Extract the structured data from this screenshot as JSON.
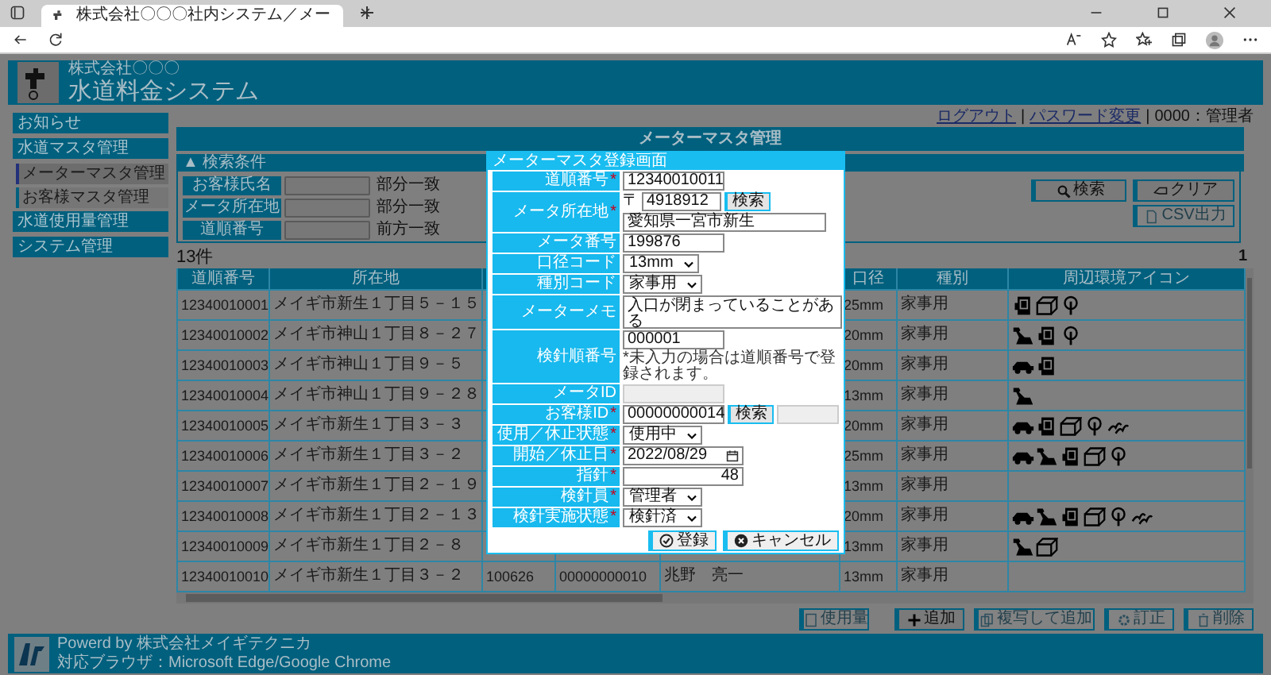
{
  "browser": {
    "tab_title": "株式会社〇〇〇社内システム／メー"
  },
  "header": {
    "company": "株式会社〇〇〇",
    "system": "水道料金システム"
  },
  "user_bar": {
    "logout": "ログアウト",
    "separator": "|",
    "password": "パスワード変更",
    "user": "0000：管理者"
  },
  "sidebar": {
    "items": [
      {
        "label": "お知らせ"
      },
      {
        "label": "水道マスタ管理",
        "children": [
          {
            "label": "メーターマスタ管理",
            "selected": true
          },
          {
            "label": "お客様マスタ管理",
            "selected": false
          }
        ]
      },
      {
        "label": "水道使用量管理"
      },
      {
        "label": "システム管理"
      }
    ]
  },
  "page_title": "メーターマスタ管理",
  "search": {
    "toggle": "▲",
    "title": "検索条件",
    "fields": [
      {
        "label": "お客様氏名",
        "match": "部分一致"
      },
      {
        "label": "メータ所在地",
        "match": "部分一致"
      },
      {
        "label": "道順番号",
        "match": "前方一致"
      }
    ],
    "buttons": [
      {
        "label": "検索",
        "disabled": false
      },
      {
        "label": "クリア",
        "disabled": false
      },
      {
        "label": "CSV出力",
        "disabled": true
      }
    ]
  },
  "results": {
    "count": "13件",
    "page": "1",
    "columns": [
      "道順番号",
      "所在地",
      "口径",
      "種別",
      "周辺環境アイコン"
    ],
    "rows": [
      {
        "route_no": "12340010001",
        "address": "メイギ市新生１丁目５－１５",
        "bore": "25mm",
        "type": "家事用",
        "icons": [
          {
            "kind": "panel"
          },
          {
            "kind": "box"
          },
          {
            "kind": "tree"
          }
        ]
      },
      {
        "route_no": "12340010002",
        "address": "メイギ市神山１丁目８－２７",
        "bore": "20mm",
        "type": "家事用",
        "icons": [
          {
            "kind": "dog"
          },
          {
            "kind": "panel"
          },
          {
            "kind": "tree"
          }
        ]
      },
      {
        "route_no": "12340010003",
        "address": "メイギ市神山１丁目９－５",
        "bore": "20mm",
        "type": "家事用",
        "icons": [
          {
            "kind": "car"
          },
          {
            "kind": "panel"
          }
        ]
      },
      {
        "route_no": "12340010004",
        "address": "メイギ市神山１丁目９－２８",
        "bore": "13mm",
        "type": "家事用",
        "icons": [
          {
            "kind": "dog"
          }
        ]
      },
      {
        "route_no": "12340010005",
        "address": "メイギ市新生１丁目３－３",
        "bore": "20mm",
        "type": "家事用",
        "icons": [
          {
            "kind": "car"
          },
          {
            "kind": "panel"
          },
          {
            "kind": "box"
          },
          {
            "kind": "tree"
          },
          {
            "kind": "birds"
          }
        ]
      },
      {
        "route_no": "12340010006",
        "address": "メイギ市新生１丁目３－２",
        "bore": "25mm",
        "type": "家事用",
        "icons": [
          {
            "kind": "car"
          },
          {
            "kind": "dog"
          },
          {
            "kind": "panel"
          },
          {
            "kind": "box"
          },
          {
            "kind": "tree"
          }
        ]
      },
      {
        "route_no": "12340010007",
        "address": "メイギ市新生１丁目２－１９",
        "bore": "13mm",
        "type": "家事用"
      },
      {
        "route_no": "12340010008",
        "address": "メイギ市新生１丁目２－１３",
        "bore": "20mm",
        "type": "家事用",
        "icons": [
          {
            "kind": "car"
          },
          {
            "kind": "dog"
          },
          {
            "kind": "panel"
          },
          {
            "kind": "box"
          },
          {
            "kind": "tree"
          },
          {
            "kind": "birds"
          }
        ]
      },
      {
        "route_no": "12340010009",
        "address": "メイギ市新生１丁目２－８",
        "bore": "13mm",
        "type": "家事用",
        "icons": [
          {
            "kind": "dog"
          },
          {
            "kind": "box"
          }
        ]
      },
      {
        "route_no": "12340010010",
        "address": "メイギ市新生１丁目３－２",
        "meter_no": "100626",
        "customer_id": "00000000010",
        "customer_name": "兆野　亮一",
        "bore": "13mm",
        "type": "家事用"
      }
    ]
  },
  "actions": [
    {
      "label": "使用量",
      "disabled": true
    },
    {
      "label": "追加",
      "disabled": false
    },
    {
      "label": "複写して追加",
      "disabled": true
    },
    {
      "label": "訂正",
      "disabled": true
    },
    {
      "label": "削除",
      "disabled": true
    }
  ],
  "footer": {
    "powered": "Powerd by 株式会社メイギテクニカ",
    "browsers": "対応ブラウザ：Microsoft Edge/Google Chrome"
  },
  "dialog": {
    "title": "メーターマスタ登録画面",
    "required_mark": "*",
    "fields": [
      {
        "kind": "text",
        "label": "道順番号",
        "required": true,
        "disabled": false,
        "value": "12340010011"
      },
      {
        "kind": "address",
        "label": "メータ所在地",
        "required": true,
        "disabled": false,
        "zip_mark": "〒",
        "zip": "4918912",
        "button": "検索",
        "value": "愛知県一宮市新生"
      },
      {
        "kind": "text",
        "label": "メータ番号",
        "required": false,
        "disabled": false,
        "value": "199876"
      },
      {
        "kind": "select",
        "label": "口径コード",
        "required": false,
        "disabled": false,
        "value": "13mm"
      },
      {
        "kind": "select",
        "label": "種別コード",
        "required": false,
        "disabled": false,
        "value": "家事用"
      },
      {
        "kind": "textarea",
        "label": "メーターメモ",
        "required": false,
        "disabled": false,
        "value": "入口が閉まっていることがある"
      },
      {
        "kind": "text",
        "label": "検針順番号",
        "required": false,
        "disabled": false,
        "value": "000001",
        "note": "*未入力の場合は道順番号で登録されます。"
      },
      {
        "kind": "text",
        "label": "メータID",
        "required": false,
        "disabled": true
      },
      {
        "kind": "lookup",
        "label": "お客様ID",
        "required": true,
        "disabled": false,
        "value": "00000000014",
        "button": "検索"
      },
      {
        "kind": "select",
        "label": "使用／休止状態",
        "required": true,
        "disabled": false,
        "value": "使用中"
      },
      {
        "kind": "date",
        "label": "開始／休止日",
        "required": true,
        "disabled": false,
        "value": "2022/08/29"
      },
      {
        "kind": "number",
        "label": "指針",
        "required": true,
        "disabled": false,
        "value": "48"
      },
      {
        "kind": "select",
        "label": "検針員",
        "required": true,
        "disabled": false,
        "value": "管理者"
      },
      {
        "kind": "select",
        "label": "検針実施状態",
        "required": true,
        "disabled": false,
        "value": "検針済"
      }
    ],
    "buttons": [
      {
        "label": "登録"
      },
      {
        "label": "キャンセル"
      }
    ]
  }
}
